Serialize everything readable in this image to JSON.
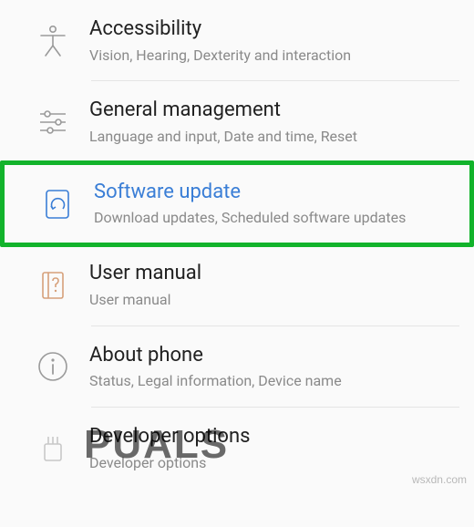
{
  "settings": [
    {
      "id": "accessibility",
      "title": "Accessibility",
      "subtitle": "Vision, Hearing, Dexterity and interaction",
      "highlighted": false
    },
    {
      "id": "general-management",
      "title": "General management",
      "subtitle": "Language and input, Date and time, Reset",
      "highlighted": false
    },
    {
      "id": "software-update",
      "title": "Software update",
      "subtitle": "Download updates, Scheduled software updates",
      "highlighted": true
    },
    {
      "id": "user-manual",
      "title": "User manual",
      "subtitle": "User manual",
      "highlighted": false
    },
    {
      "id": "about-phone",
      "title": "About phone",
      "subtitle": "Status, Legal information, Device name",
      "highlighted": false
    },
    {
      "id": "developer-options",
      "title": "Developer options",
      "subtitle": "Developer options",
      "highlighted": false
    }
  ],
  "watermark_brand": "PUALS",
  "watermark_site": "wsxdn.com"
}
